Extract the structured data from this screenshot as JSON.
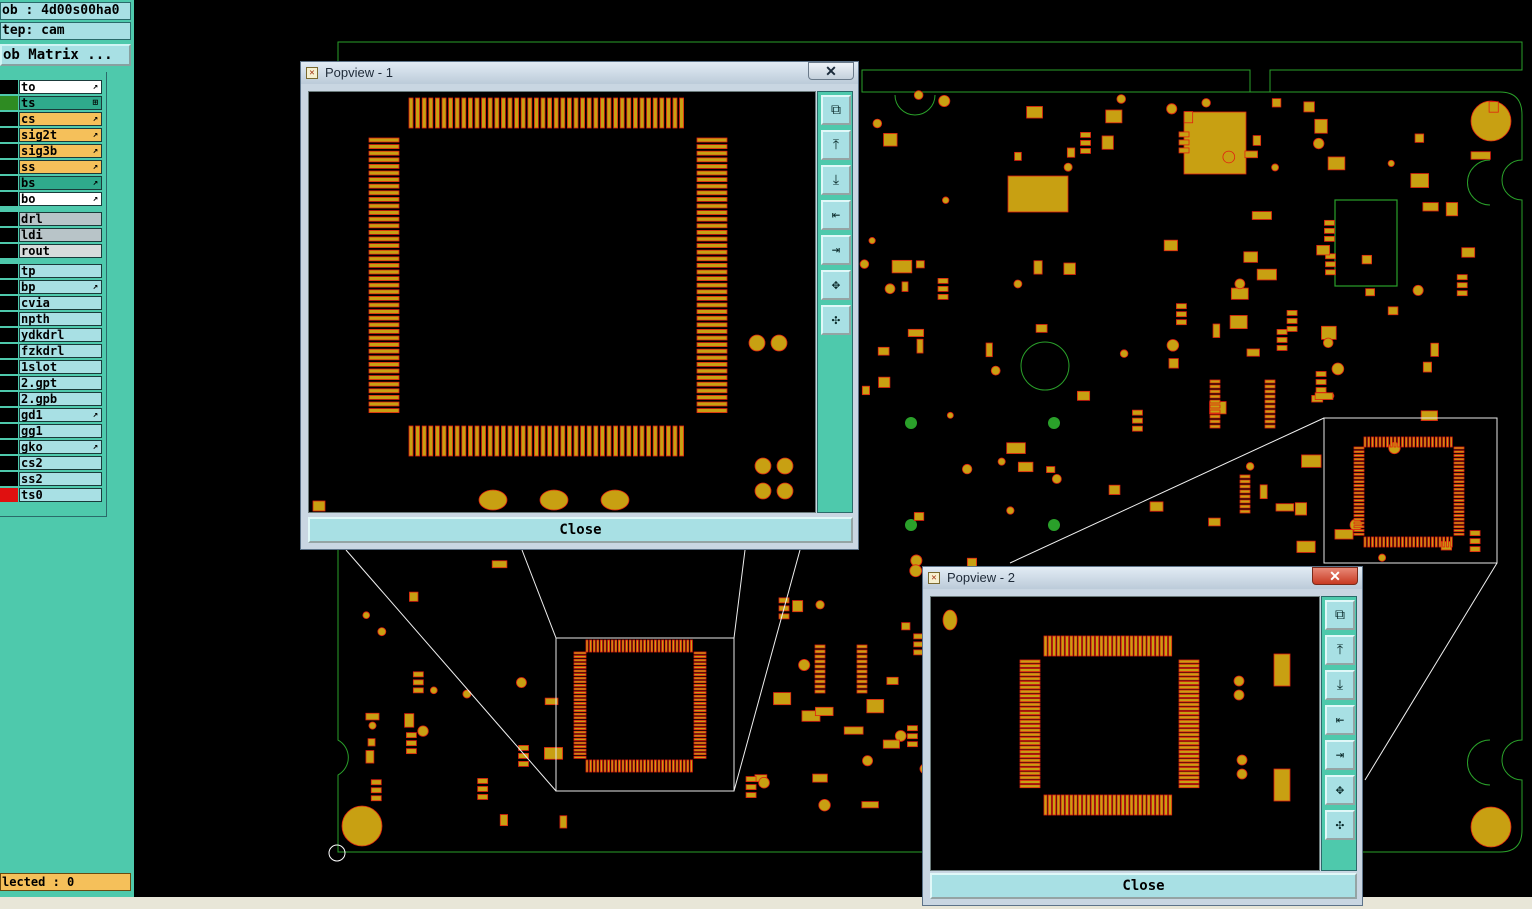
{
  "header": {
    "job_label": "ob : 4d00s00ha0",
    "step_label": "tep: cam",
    "matrix_button": "ob Matrix ..."
  },
  "layers": [
    {
      "name": "to",
      "color": "#ffffff",
      "swatch": "#000000",
      "arrow": "↗"
    },
    {
      "name": "ts",
      "color": "#2faa8c",
      "swatch": "#2e8b22",
      "arrow": "⊞"
    },
    {
      "name": "cs",
      "color": "#f5c05a",
      "swatch": "#000000",
      "arrow": "↗"
    },
    {
      "name": "sig2t",
      "color": "#f5c05a",
      "swatch": "#000000",
      "arrow": "↗"
    },
    {
      "name": "sig3b",
      "color": "#f5c05a",
      "swatch": "#000000",
      "arrow": "↗"
    },
    {
      "name": "ss",
      "color": "#f5c05a",
      "swatch": "#000000",
      "arrow": "↗"
    },
    {
      "name": "bs",
      "color": "#2faa8c",
      "swatch": "#000000",
      "arrow": "↗"
    },
    {
      "name": "bo",
      "color": "#ffffff",
      "swatch": "#000000",
      "arrow": "↗"
    },
    {
      "name": "drl",
      "color": "#b8c4c8",
      "swatch": "#000000",
      "arrow": ""
    },
    {
      "name": "ldi",
      "color": "#b8c4c8",
      "swatch": "#000000",
      "arrow": ""
    },
    {
      "name": "rout",
      "color": "#d8dcdc",
      "swatch": "#000000",
      "arrow": ""
    },
    {
      "name": "tp",
      "color": "#a8e0e4",
      "swatch": "#000000",
      "arrow": ""
    },
    {
      "name": "bp",
      "color": "#a8e0e4",
      "swatch": "#000000",
      "arrow": "↗"
    },
    {
      "name": "cvia",
      "color": "#a8e0e4",
      "swatch": "#000000",
      "arrow": ""
    },
    {
      "name": "npth",
      "color": "#a8e0e4",
      "swatch": "#000000",
      "arrow": ""
    },
    {
      "name": "ydkdrl",
      "color": "#a8e0e4",
      "swatch": "#000000",
      "arrow": ""
    },
    {
      "name": "fzkdrl",
      "color": "#a8e0e4",
      "swatch": "#000000",
      "arrow": ""
    },
    {
      "name": "1slot",
      "color": "#a8e0e4",
      "swatch": "#000000",
      "arrow": ""
    },
    {
      "name": "2.gpt",
      "color": "#a8e0e4",
      "swatch": "#000000",
      "arrow": ""
    },
    {
      "name": "2.gpb",
      "color": "#a8e0e4",
      "swatch": "#000000",
      "arrow": ""
    },
    {
      "name": "gd1",
      "color": "#a8e0e4",
      "swatch": "#000000",
      "arrow": "↗"
    },
    {
      "name": "gg1",
      "color": "#a8e0e4",
      "swatch": "#000000",
      "arrow": ""
    },
    {
      "name": "gko",
      "color": "#a8e0e4",
      "swatch": "#000000",
      "arrow": "↗"
    },
    {
      "name": "cs2",
      "color": "#a8e0e4",
      "swatch": "#000000",
      "arrow": ""
    },
    {
      "name": "ss2",
      "color": "#a8e0e4",
      "swatch": "#000000",
      "arrow": ""
    },
    {
      "name": "ts0",
      "color": "#a8e0e4",
      "swatch": "#e01010",
      "arrow": ""
    }
  ],
  "status": {
    "selected": "lected : 0"
  },
  "popview1": {
    "title": "Popview - 1",
    "close_label": "Close",
    "x_glyph": "✕"
  },
  "popview2": {
    "title": "Popview - 2",
    "close_label": "Close",
    "x_glyph": "✕"
  },
  "toolbar_icons": [
    "zoom-fit-icon",
    "pan-up-icon",
    "pan-down-icon",
    "pan-left-icon",
    "pan-right-icon",
    "zoom-in-icon",
    "zoom-out-icon"
  ],
  "colors": {
    "pad": "#c8a012",
    "pad_outline": "#e02010",
    "board_outline": "#2aa02a",
    "panel": "#4ec9ac",
    "button": "#a8e0e4"
  }
}
